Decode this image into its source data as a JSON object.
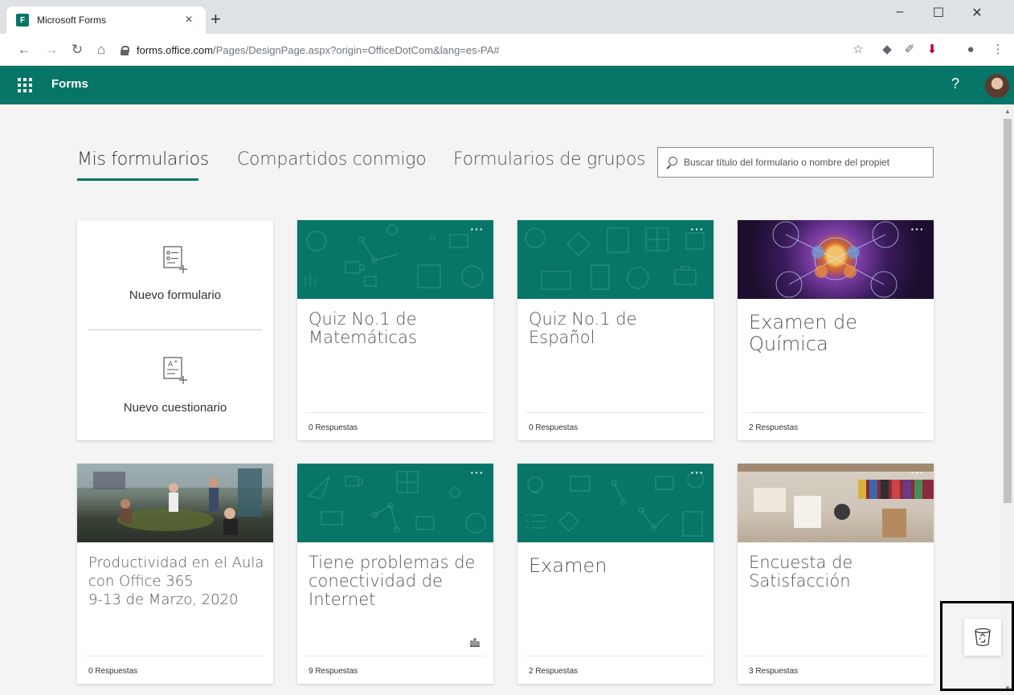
{
  "browser": {
    "tab_title": "Microsoft Forms",
    "tab_favicon_text": "F",
    "url_host": "forms.office.com",
    "url_path": "/Pages/DesignPage.aspx?origin=OfficeDotCom&lang=es-PA#"
  },
  "app": {
    "title": "Forms",
    "help": "?"
  },
  "tabs": [
    {
      "label": "Mis formularios",
      "active": true
    },
    {
      "label": "Compartidos conmigo",
      "active": false
    },
    {
      "label": "Formularios de grupos",
      "active": false
    }
  ],
  "search": {
    "placeholder": "Buscar título del formulario o nombre del propiet"
  },
  "new_card": {
    "new_form": "Nuevo formulario",
    "new_quiz": "Nuevo cuestionario"
  },
  "cards": [
    {
      "title": "Quiz No.1 de Matemáticas",
      "responses": "0 Respuestas",
      "banner": "green-pattern"
    },
    {
      "title": "Quiz No.1 de Español",
      "responses": "0 Respuestas",
      "banner": "green-pattern"
    },
    {
      "title": "Examen de Química",
      "responses": "2 Respuestas",
      "banner": "purple-flower-photo"
    },
    {
      "title": "Productividad en el Aula con Office 365\n9-13 de Marzo, 2020",
      "responses": "0 Respuestas",
      "banner": "office-photo"
    },
    {
      "title": "Tiene problemas de conectividad de Internet",
      "responses": "9 Respuestas",
      "banner": "green-pattern"
    },
    {
      "title": "Examen",
      "responses": "2 Respuestas",
      "banner": "green-pattern"
    },
    {
      "title": "Encuesta de Satisfacción",
      "responses": "3 Respuestas",
      "banner": "design-desk-photo"
    }
  ],
  "more_label": "···",
  "colors": {
    "brand": "#077568",
    "tabbar": "#dee1e6",
    "page_bg": "#f4f4f4"
  }
}
